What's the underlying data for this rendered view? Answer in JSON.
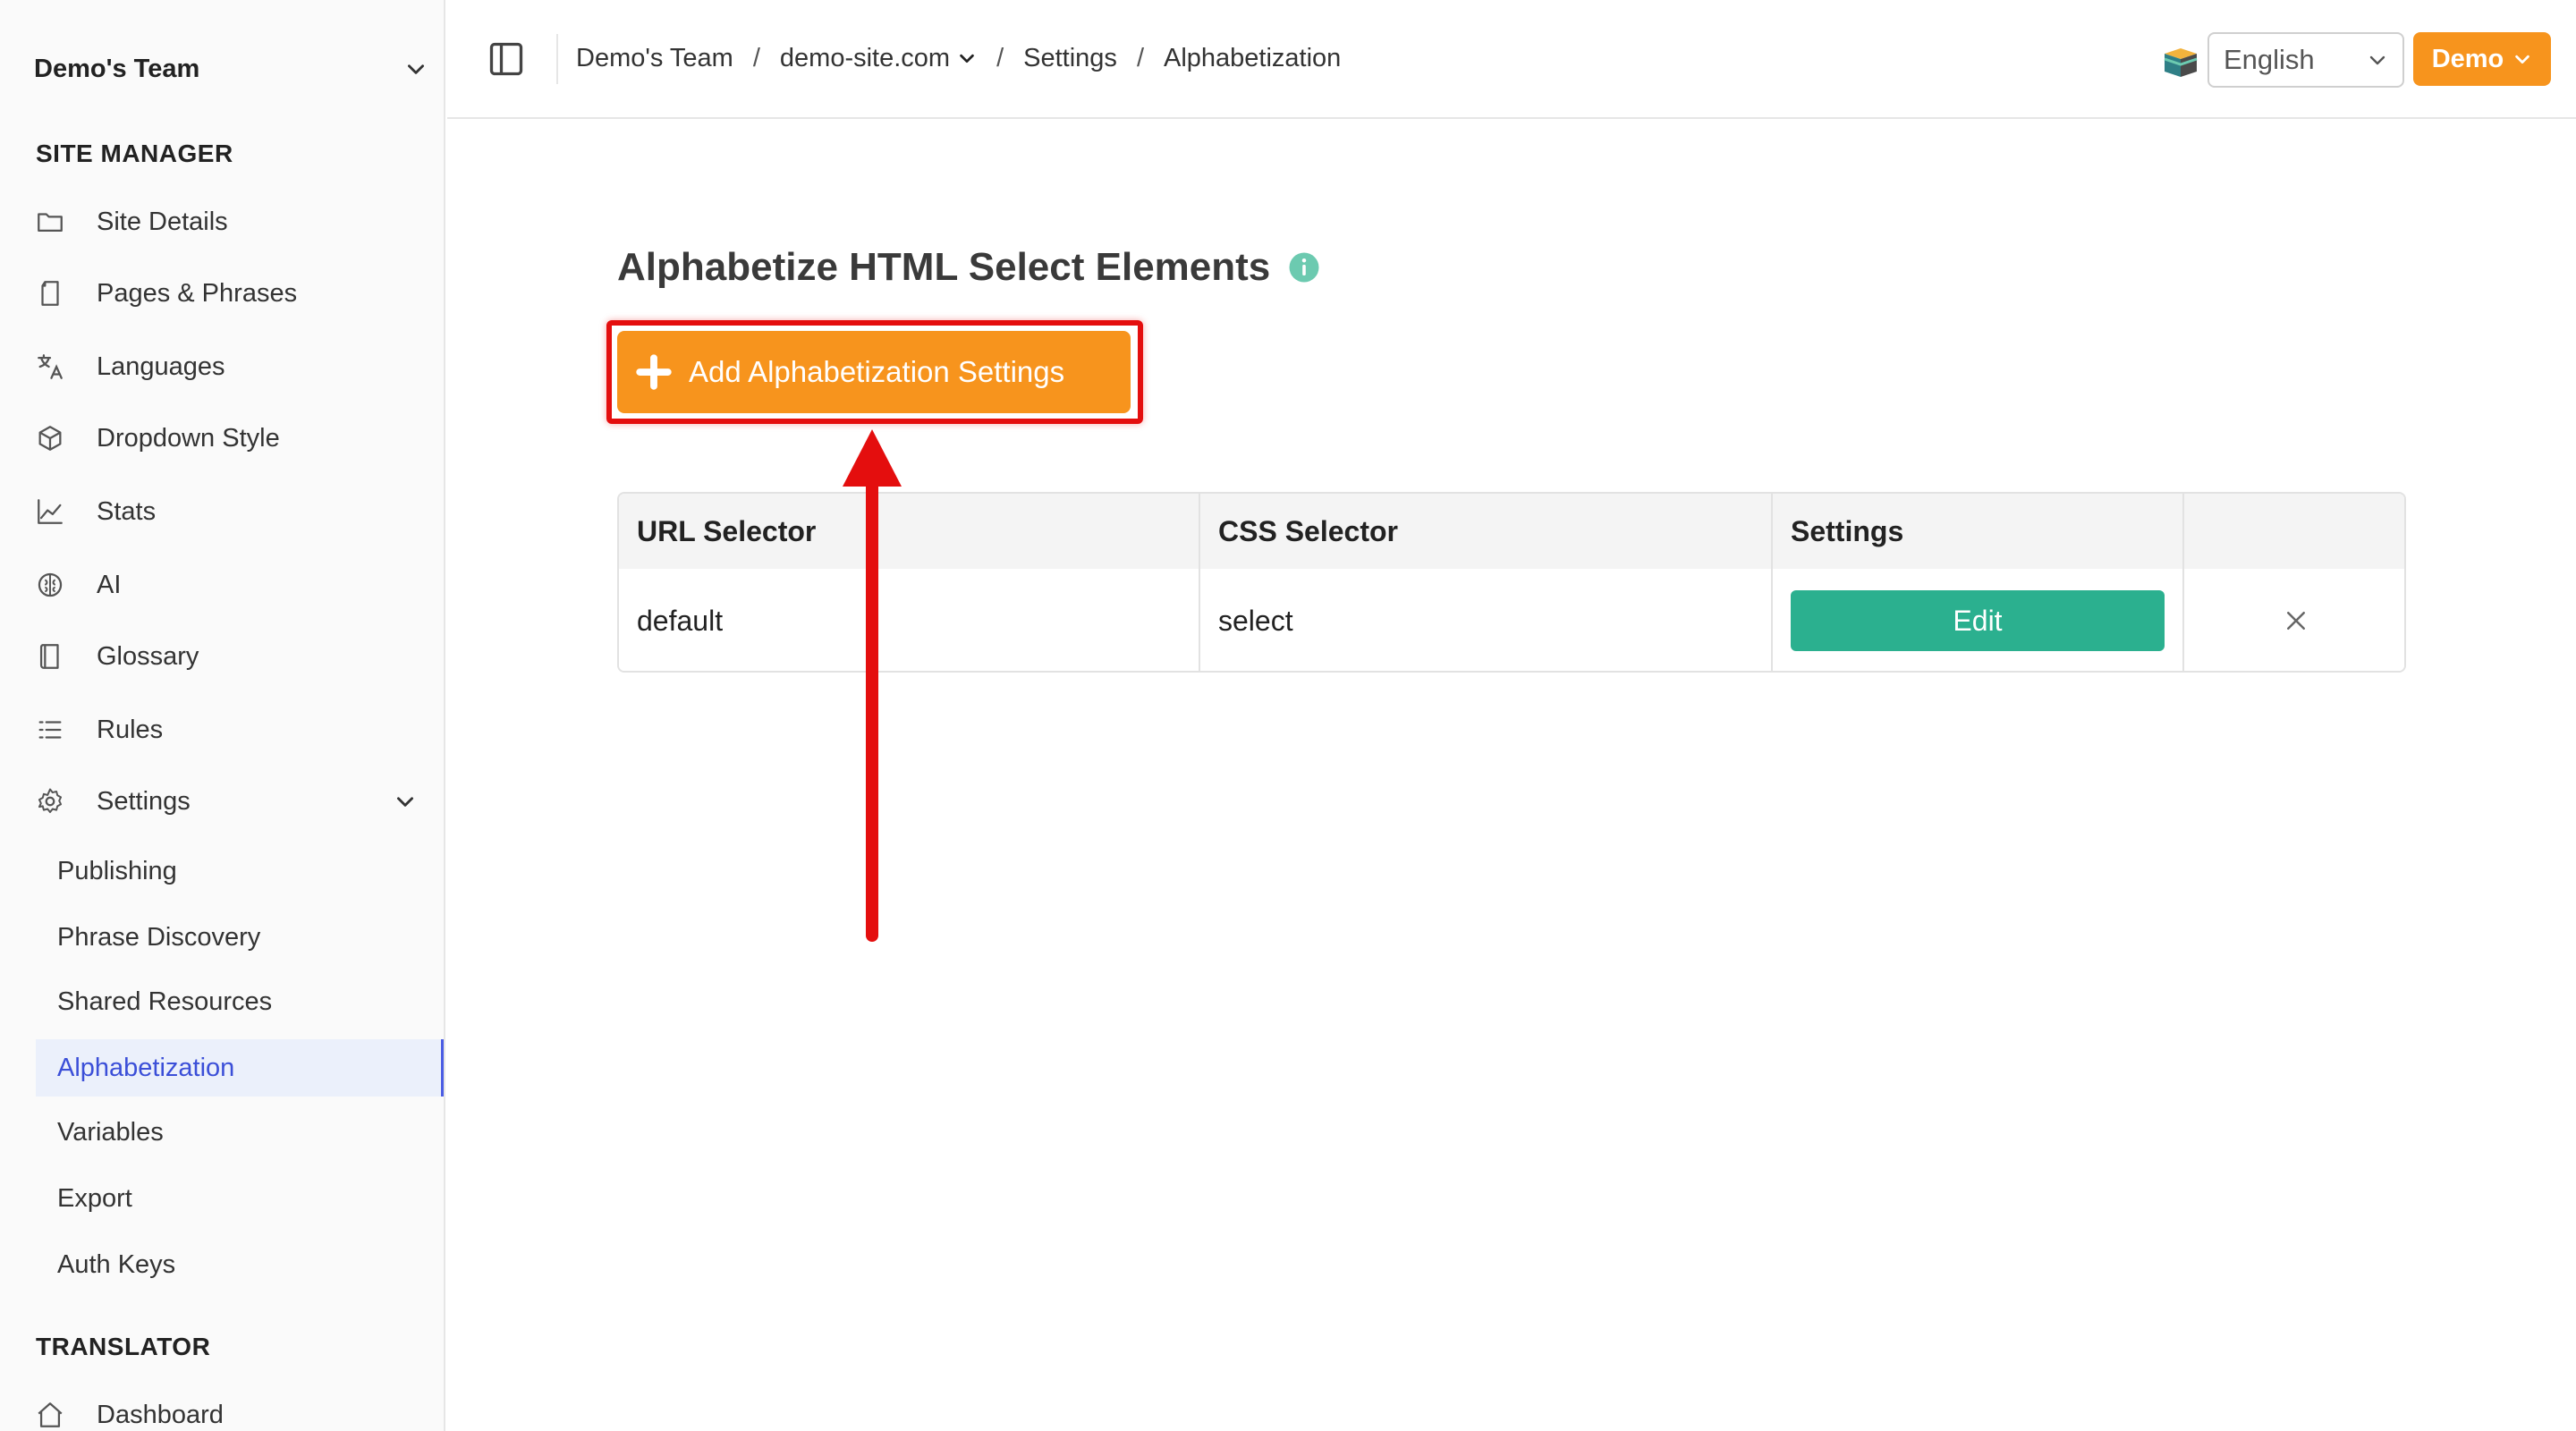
{
  "sidebar": {
    "team_name": "Demo's Team",
    "site_manager_title": "SITE MANAGER",
    "items": [
      {
        "label": "Site Details",
        "icon": "folder-icon"
      },
      {
        "label": "Pages & Phrases",
        "icon": "file-icon"
      },
      {
        "label": "Languages",
        "icon": "translate-icon"
      },
      {
        "label": "Dropdown Style",
        "icon": "cube-icon"
      },
      {
        "label": "Stats",
        "icon": "line-chart-icon"
      },
      {
        "label": "AI",
        "icon": "brain-icon"
      },
      {
        "label": "Glossary",
        "icon": "book-icon"
      },
      {
        "label": "Rules",
        "icon": "list-icon"
      },
      {
        "label": "Settings",
        "icon": "gear-icon"
      }
    ],
    "settings_sub": [
      {
        "label": "Publishing"
      },
      {
        "label": "Phrase Discovery"
      },
      {
        "label": "Shared Resources"
      },
      {
        "label": "Alphabetization"
      },
      {
        "label": "Variables"
      },
      {
        "label": "Export"
      },
      {
        "label": "Auth Keys"
      }
    ],
    "translator_title": "TRANSLATOR",
    "dashboard_label": "Dashboard"
  },
  "topbar": {
    "breadcrumb": [
      "Demo's Team",
      "demo-site.com",
      "Settings",
      "Alphabetization"
    ],
    "separator": "/",
    "language": "English",
    "account_label": "Demo"
  },
  "main": {
    "title": "Alphabetize HTML Select Elements",
    "add_button_label": "Add Alphabetization Settings",
    "table": {
      "headers": [
        "URL Selector",
        "CSS Selector",
        "Settings",
        ""
      ],
      "rows": [
        {
          "url_selector": "default",
          "css_selector": "select",
          "edit_label": "Edit"
        }
      ]
    }
  },
  "colors": {
    "accent_orange": "#f7941d",
    "edit_green": "#2bb08f",
    "active_blue": "#3b4fd8",
    "annotation_red": "#e40e0e",
    "info_teal": "#6ccab0"
  }
}
